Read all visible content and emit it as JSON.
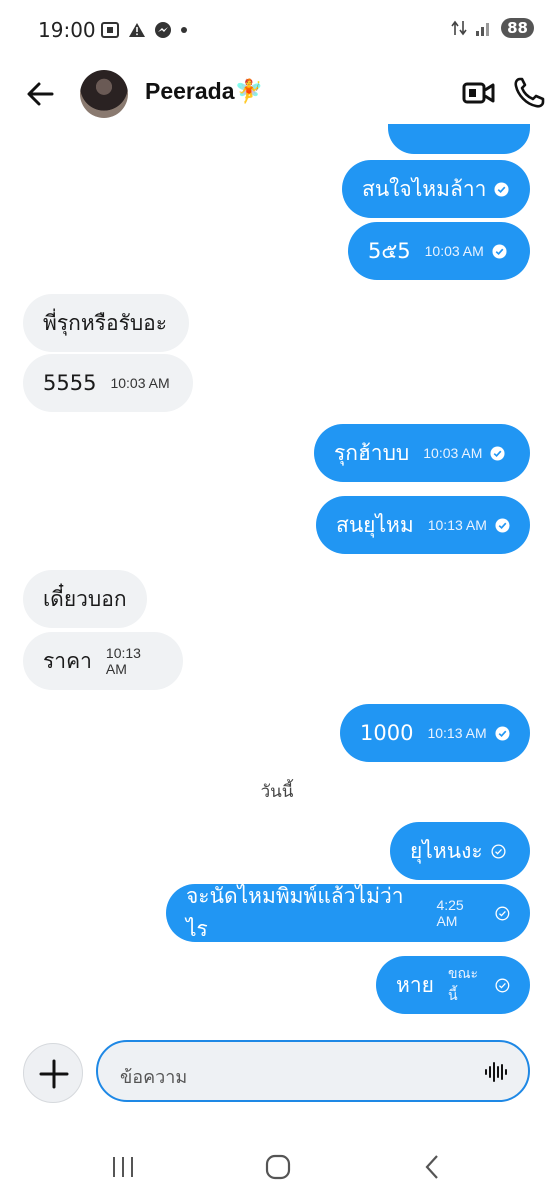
{
  "status_bar": {
    "time": "19:00",
    "battery": "88"
  },
  "header": {
    "contact_name": "Peerada",
    "contact_emoji": "🧚"
  },
  "messages": [
    {
      "text": "สนใจไหมล้าา",
      "time": ""
    },
    {
      "text": "5๕5",
      "time": "10:03 AM"
    },
    {
      "text": "พี่รุกหรือรับอะ",
      "time": ""
    },
    {
      "text": "5555",
      "time": "10:03 AM"
    },
    {
      "text": "รุกฮ้าบบ",
      "time": "10:03 AM"
    },
    {
      "text": "สนยุไหม",
      "time": "10:13 AM"
    },
    {
      "text": "เดี๋ยวบอก",
      "time": ""
    },
    {
      "text": "ราคา",
      "time": "10:13 AM"
    },
    {
      "text": "1000",
      "time": "10:13 AM"
    },
    {
      "text": "ยุไหนงะ",
      "time": ""
    },
    {
      "text": "จะนัดไหมพิมพ์แล้วไม่ว่าไร",
      "time": "4:25 AM"
    },
    {
      "text": "หาย",
      "time": "ขณะนี้"
    }
  ],
  "date_separator": "วันนี้",
  "composer": {
    "placeholder": "ข้อความ"
  },
  "icons": {
    "back": "arrow-left-icon",
    "video": "video-camera-icon",
    "call": "phone-icon",
    "plus": "plus-icon",
    "voice": "waveform-icon",
    "read": "check-circle-icon"
  },
  "colors": {
    "outgoing_bubble": "#2196f3",
    "incoming_bubble": "#f0f2f4",
    "accent": "#1e88e5"
  }
}
